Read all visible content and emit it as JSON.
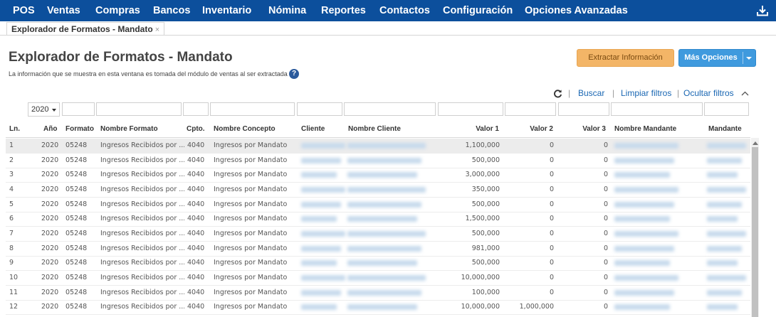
{
  "nav": {
    "items": [
      "POS",
      "Ventas",
      "Compras",
      "Bancos",
      "Inventario",
      "Nómina",
      "Reportes",
      "Contactos",
      "Configuración",
      "Opciones Avanzadas"
    ],
    "download_icon": "download-icon"
  },
  "tab": {
    "label": "Explorador de Formatos - Mandato",
    "close": "×"
  },
  "page": {
    "title": "Explorador de Formatos - Mandato",
    "subtitle": "La información que se muestra en esta ventana es tomada del módulo de ventas al ser extractada",
    "help": "?"
  },
  "buttons": {
    "extract": "Extractar Información",
    "more": "Más Opciones"
  },
  "toolbar": {
    "search": "Buscar",
    "clear": "Limpiar filtros",
    "hide": "Ocultar filtros"
  },
  "filters": {
    "year": "2020"
  },
  "grid": {
    "headers": [
      "Ln.",
      "Año",
      "Formato",
      "Nombre Formato",
      "Cpto.",
      "Nombre Concepto",
      "Cliente",
      "Nombre Cliente",
      "Valor 1",
      "Valor 2",
      "Valor 3",
      "Nombre Mandante",
      "Mandante"
    ],
    "rows": [
      {
        "ln": "1",
        "year": "2020",
        "fmt": "05248",
        "fmt_name": "Ingresos Recibidos por ...",
        "cpto": "4040",
        "concept": "Ingresos por Mandato",
        "v1": "1,100,000",
        "v2": "0",
        "v3": "0"
      },
      {
        "ln": "2",
        "year": "2020",
        "fmt": "05248",
        "fmt_name": "Ingresos Recibidos por ...",
        "cpto": "4040",
        "concept": "Ingresos por Mandato",
        "v1": "500,000",
        "v2": "0",
        "v3": "0"
      },
      {
        "ln": "3",
        "year": "2020",
        "fmt": "05248",
        "fmt_name": "Ingresos Recibidos por ...",
        "cpto": "4040",
        "concept": "Ingresos por Mandato",
        "v1": "3,000,000",
        "v2": "0",
        "v3": "0"
      },
      {
        "ln": "4",
        "year": "2020",
        "fmt": "05248",
        "fmt_name": "Ingresos Recibidos por ...",
        "cpto": "4040",
        "concept": "Ingresos por Mandato",
        "v1": "350,000",
        "v2": "0",
        "v3": "0"
      },
      {
        "ln": "5",
        "year": "2020",
        "fmt": "05248",
        "fmt_name": "Ingresos Recibidos por ...",
        "cpto": "4040",
        "concept": "Ingresos por Mandato",
        "v1": "500,000",
        "v2": "0",
        "v3": "0"
      },
      {
        "ln": "6",
        "year": "2020",
        "fmt": "05248",
        "fmt_name": "Ingresos Recibidos por ...",
        "cpto": "4040",
        "concept": "Ingresos por Mandato",
        "v1": "1,500,000",
        "v2": "0",
        "v3": "0"
      },
      {
        "ln": "7",
        "year": "2020",
        "fmt": "05248",
        "fmt_name": "Ingresos Recibidos por ...",
        "cpto": "4040",
        "concept": "Ingresos por Mandato",
        "v1": "500,000",
        "v2": "0",
        "v3": "0"
      },
      {
        "ln": "8",
        "year": "2020",
        "fmt": "05248",
        "fmt_name": "Ingresos Recibidos por ...",
        "cpto": "4040",
        "concept": "Ingresos por Mandato",
        "v1": "981,000",
        "v2": "0",
        "v3": "0"
      },
      {
        "ln": "9",
        "year": "2020",
        "fmt": "05248",
        "fmt_name": "Ingresos Recibidos por ...",
        "cpto": "4040",
        "concept": "Ingresos por Mandato",
        "v1": "500,000",
        "v2": "0",
        "v3": "0"
      },
      {
        "ln": "10",
        "year": "2020",
        "fmt": "05248",
        "fmt_name": "Ingresos Recibidos por ...",
        "cpto": "4040",
        "concept": "Ingresos por Mandato",
        "v1": "10,000,000",
        "v2": "0",
        "v3": "0"
      },
      {
        "ln": "11",
        "year": "2020",
        "fmt": "05248",
        "fmt_name": "Ingresos Recibidos por ...",
        "cpto": "4040",
        "concept": "Ingresos por Mandato",
        "v1": "100,000",
        "v2": "0",
        "v3": "0"
      },
      {
        "ln": "12",
        "year": "2020",
        "fmt": "05248",
        "fmt_name": "Ingresos Recibidos por ...",
        "cpto": "4040",
        "concept": "Ingresos por Mandato",
        "v1": "10,000,000",
        "v2": "1,000,000",
        "v3": "0"
      }
    ]
  },
  "colors": {
    "nav_bg": "#0c4f9c",
    "extract_btn": "#f3b567",
    "more_btn": "#3f9ade",
    "link": "#1a67b3",
    "selected_row": "#ececec"
  }
}
